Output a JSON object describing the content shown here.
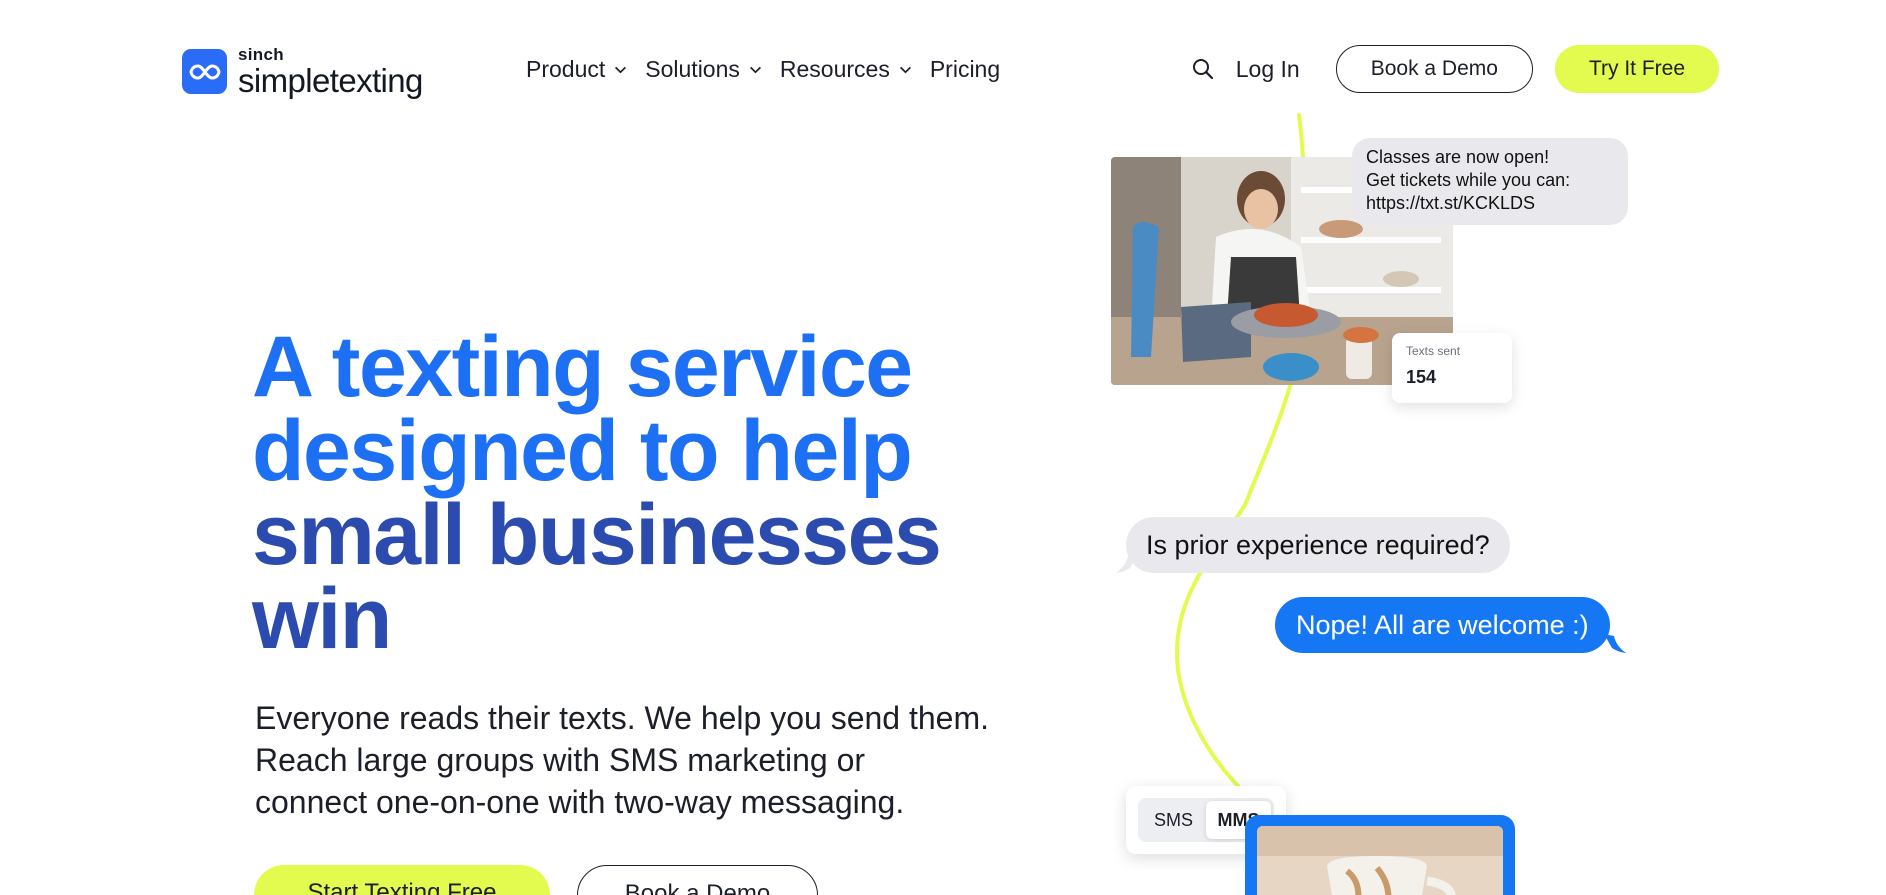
{
  "brand": {
    "company": "sinch",
    "name": "simpletexting",
    "accent_blue": "#1d6ff4",
    "dark_blue": "#2b4cae",
    "lime": "#e3fa4e"
  },
  "nav": {
    "items": [
      {
        "label": "Product",
        "has_dropdown": true
      },
      {
        "label": "Solutions",
        "has_dropdown": true
      },
      {
        "label": "Resources",
        "has_dropdown": true
      },
      {
        "label": "Pricing",
        "has_dropdown": false
      }
    ],
    "login": "Log In",
    "book_demo": "Book a Demo",
    "try_free": "Try It Free"
  },
  "hero": {
    "title_lines": [
      "A texting service",
      "designed to help",
      "small businesses",
      "win"
    ],
    "subtitle_lines": [
      "Everyone reads their texts. We help you send them.",
      "Reach large groups with SMS marketing or",
      "connect one-on-one with two-way messaging."
    ],
    "cta_primary": "Start Texting Free",
    "cta_secondary": "Book a Demo"
  },
  "illustration": {
    "message_lines": [
      "Classes are now open!",
      "Get tickets while you can:",
      "https://txt.st/KCKLDS"
    ],
    "stat": {
      "label": "Texts sent",
      "value": "154"
    },
    "question": "Is prior experience required?",
    "answer": "Nope! All are welcome :)",
    "toggle": {
      "options": [
        "SMS",
        "MMS"
      ],
      "selected": "MMS"
    }
  }
}
